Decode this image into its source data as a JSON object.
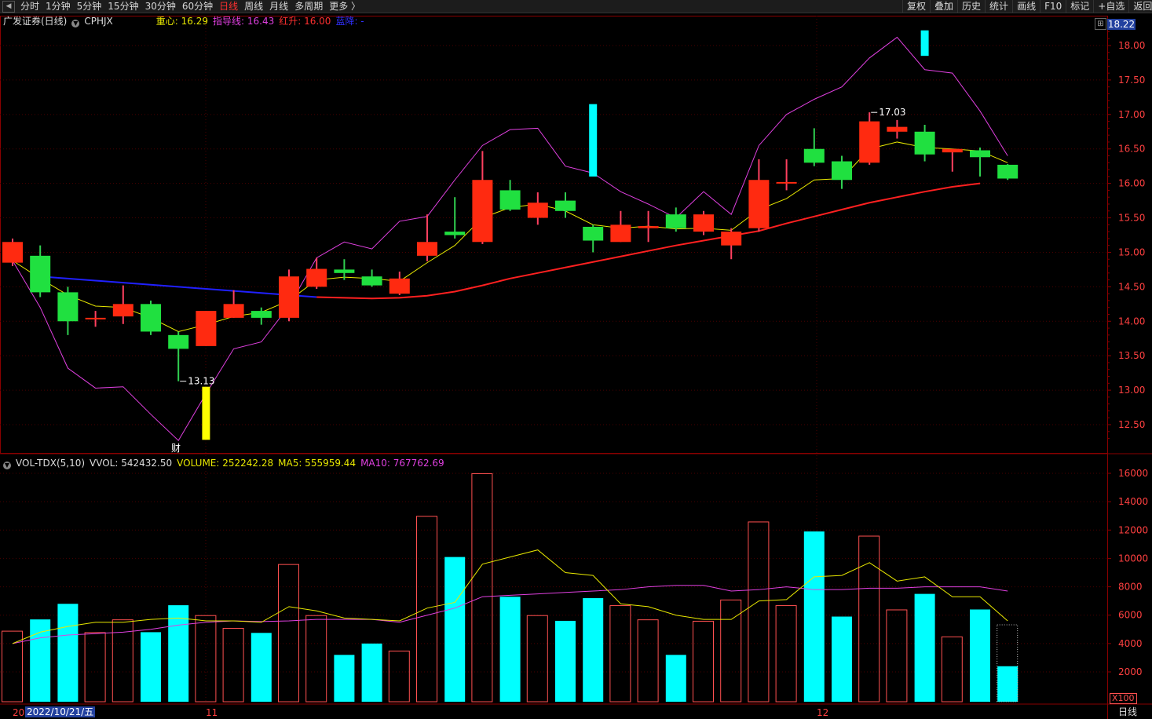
{
  "toolbar": {
    "left_items": [
      "分时",
      "1分钟",
      "5分钟",
      "15分钟",
      "30分钟",
      "60分钟",
      "日线",
      "周线",
      "月线",
      "多周期",
      "更多 〉"
    ],
    "active_item": "日线",
    "right_items": [
      "复权",
      "叠加",
      "历史",
      "统计",
      "画线",
      "F10",
      "标记",
      "+自选",
      "返回"
    ]
  },
  "main_header": {
    "stock_name": "广发证券(日线)",
    "code": "CPHJX",
    "indicators": [
      {
        "label": "重心: 16.29",
        "color": "#e8e800"
      },
      {
        "label": "指导线: 16.43",
        "color": "#e040e0"
      },
      {
        "label": "红升: 16.00",
        "color": "#ff3030"
      },
      {
        "label": "蓝降: -",
        "color": "#3030ff"
      }
    ],
    "box_icon": "⊞"
  },
  "price_tag": "18.22",
  "price_axis": [
    "18.00",
    "17.50",
    "17.00",
    "16.50",
    "16.00",
    "15.50",
    "15.00",
    "14.50",
    "14.00",
    "13.50",
    "13.00",
    "12.50"
  ],
  "annotations": {
    "low": "13.13",
    "high": "17.03",
    "fin_marker": "财"
  },
  "volume_header": {
    "name": "VOL-TDX(5,10)",
    "items": [
      {
        "label": "VVOL: 542432.50",
        "color": "#dddddd"
      },
      {
        "label": "VOLUME: 252242.28",
        "color": "#e8e800"
      },
      {
        "label": "MA5: 555959.44",
        "color": "#e8e800"
      },
      {
        "label": "MA10: 767762.69",
        "color": "#e040e0"
      }
    ]
  },
  "volume_axis": [
    "16000",
    "14000",
    "12000",
    "10000",
    "8000",
    "6000",
    "4000",
    "2000"
  ],
  "volume_unit": "X100",
  "date_axis": {
    "items": [
      "20",
      "11",
      "12"
    ],
    "cursor_date": "2022/10/21/五",
    "period": "日线"
  },
  "colors": {
    "up": "#ff2a10",
    "down": "#20e040",
    "vol_down": "#00ffff",
    "vol_up": "#ff5050",
    "ma_center": "#e8e800",
    "guide": "#e040e0",
    "red_up": "#ff2020",
    "blue_down": "#2020ff",
    "grid": "#4a0000",
    "axis": "#8a0000"
  },
  "chart_data": {
    "type": "candlestick",
    "price_ylim": [
      12.2,
      18.35
    ],
    "volume_ylim": [
      0,
      16500
    ],
    "candles": [
      {
        "o": 14.85,
        "h": 15.2,
        "l": 14.8,
        "c": 15.15
      },
      {
        "o": 14.95,
        "h": 15.1,
        "l": 14.35,
        "c": 14.42
      },
      {
        "o": 14.42,
        "h": 14.5,
        "l": 13.8,
        "c": 14.0
      },
      {
        "o": 14.03,
        "h": 14.15,
        "l": 13.92,
        "c": 14.05
      },
      {
        "o": 14.07,
        "h": 14.52,
        "l": 13.96,
        "c": 14.25
      },
      {
        "o": 14.25,
        "h": 14.3,
        "l": 13.8,
        "c": 13.85
      },
      {
        "o": 13.8,
        "h": 13.85,
        "l": 13.13,
        "c": 13.6
      },
      {
        "o": 13.64,
        "h": 14.15,
        "l": 13.64,
        "c": 14.15
      },
      {
        "o": 14.05,
        "h": 14.45,
        "l": 14.05,
        "c": 14.25
      },
      {
        "o": 14.15,
        "h": 14.2,
        "l": 13.95,
        "c": 14.05
      },
      {
        "o": 14.05,
        "h": 14.75,
        "l": 14.0,
        "c": 14.65
      },
      {
        "o": 14.5,
        "h": 14.92,
        "l": 14.47,
        "c": 14.76
      },
      {
        "o": 14.75,
        "h": 14.9,
        "l": 14.6,
        "c": 14.7
      },
      {
        "o": 14.65,
        "h": 14.75,
        "l": 14.5,
        "c": 14.52
      },
      {
        "o": 14.4,
        "h": 14.72,
        "l": 14.38,
        "c": 14.62
      },
      {
        "o": 14.95,
        "h": 15.55,
        "l": 14.87,
        "c": 15.15
      },
      {
        "o": 15.3,
        "h": 15.8,
        "l": 15.2,
        "c": 15.25
      },
      {
        "o": 15.15,
        "h": 16.47,
        "l": 15.12,
        "c": 16.05
      },
      {
        "o": 15.9,
        "h": 16.05,
        "l": 15.6,
        "c": 15.62
      },
      {
        "o": 15.5,
        "h": 15.87,
        "l": 15.4,
        "c": 15.72
      },
      {
        "o": 15.75,
        "h": 15.87,
        "l": 15.5,
        "c": 15.6
      },
      {
        "o": 15.37,
        "h": 15.4,
        "l": 15.0,
        "c": 15.17
      },
      {
        "o": 15.15,
        "h": 15.6,
        "l": 15.15,
        "c": 15.4
      },
      {
        "o": 15.35,
        "h": 15.6,
        "l": 15.15,
        "c": 15.38
      },
      {
        "o": 15.55,
        "h": 15.65,
        "l": 15.3,
        "c": 15.35
      },
      {
        "o": 15.3,
        "h": 15.6,
        "l": 15.25,
        "c": 15.55
      },
      {
        "o": 15.1,
        "h": 15.35,
        "l": 14.9,
        "c": 15.3
      },
      {
        "o": 15.35,
        "h": 16.35,
        "l": 15.3,
        "c": 16.05
      },
      {
        "o": 16.0,
        "h": 16.35,
        "l": 15.9,
        "c": 16.02
      },
      {
        "o": 16.5,
        "h": 16.8,
        "l": 16.25,
        "c": 16.3
      },
      {
        "o": 16.32,
        "h": 16.4,
        "l": 15.92,
        "c": 16.05
      },
      {
        "o": 16.3,
        "h": 17.03,
        "l": 16.27,
        "c": 16.9
      },
      {
        "o": 16.75,
        "h": 16.92,
        "l": 16.65,
        "c": 16.82
      },
      {
        "o": 16.75,
        "h": 16.85,
        "l": 16.32,
        "c": 16.42
      },
      {
        "o": 16.45,
        "h": 16.5,
        "l": 16.17,
        "c": 16.5
      },
      {
        "o": 16.48,
        "h": 16.52,
        "l": 16.1,
        "c": 16.38
      },
      {
        "o": 16.27,
        "h": 16.28,
        "l": 16.05,
        "c": 16.07
      }
    ],
    "volume": [
      4900,
      5700,
      6800,
      4800,
      5700,
      4800,
      6700,
      6000,
      5100,
      4750,
      9600,
      6000,
      3200,
      4000,
      3500,
      13000,
      10100,
      16000,
      7300,
      6000,
      5600,
      7200,
      6700,
      5700,
      3200,
      5600,
      7100,
      12600,
      6700,
      11900,
      5900,
      11600,
      6400,
      7500,
      4500,
      6400,
      2400
    ],
    "volume_last_outline": 5350,
    "ma_center": [
      14.88,
      14.62,
      14.38,
      14.22,
      14.2,
      14.05,
      13.85,
      13.95,
      14.07,
      14.13,
      14.3,
      14.6,
      14.64,
      14.62,
      14.58,
      14.85,
      15.1,
      15.5,
      15.65,
      15.7,
      15.6,
      15.4,
      15.35,
      15.38,
      15.34,
      15.35,
      15.32,
      15.62,
      15.78,
      16.05,
      16.07,
      16.5,
      16.6,
      16.52,
      16.5,
      16.47,
      16.3
    ],
    "guide_line": [
      14.88,
      14.2,
      13.32,
      13.03,
      13.05,
      12.65,
      12.27,
      12.95,
      13.6,
      13.7,
      14.22,
      14.92,
      15.15,
      15.05,
      15.45,
      15.52,
      16.05,
      16.55,
      16.78,
      16.8,
      16.25,
      16.15,
      15.88,
      15.7,
      15.5,
      15.88,
      15.55,
      16.55,
      17.0,
      17.22,
      17.4,
      17.82,
      18.12,
      17.65,
      17.6,
      17.05,
      16.4
    ],
    "red_up_start": 11,
    "red_up": [
      14.35,
      14.34,
      14.33,
      14.34,
      14.37,
      14.43,
      14.52,
      14.62,
      14.7,
      14.78,
      14.86,
      14.94,
      15.02,
      15.1,
      15.17,
      15.24,
      15.31,
      15.42,
      15.52,
      15.62,
      15.72,
      15.8,
      15.88,
      15.95,
      16.0
    ],
    "blue_down_start": 1,
    "blue_down": [
      14.65,
      14.62,
      14.59,
      14.56,
      14.53,
      14.5,
      14.47,
      14.44,
      14.41,
      14.38,
      14.35
    ],
    "vol_ma5": [
      4000,
      4800,
      5200,
      5500,
      5500,
      5700,
      5800,
      5600,
      5600,
      5500,
      6600,
      6300,
      5800,
      5700,
      5600,
      6500,
      6900,
      9600,
      10100,
      10600,
      9000,
      8800,
      6800,
      6600,
      6000,
      5700,
      5700,
      7000,
      7100,
      8700,
      8800,
      9700,
      8400,
      8700,
      7300,
      7300,
      5600
    ],
    "vol_ma10": [
      4000,
      4400,
      4600,
      4700,
      4800,
      5000,
      5300,
      5500,
      5600,
      5550,
      5600,
      5700,
      5700,
      5700,
      5500,
      6000,
      6500,
      7300,
      7400,
      7500,
      7600,
      7700,
      7800,
      8000,
      8100,
      8100,
      7700,
      7800,
      8000,
      7800,
      7800,
      7900,
      7900,
      8000,
      8000,
      8000,
      7700
    ],
    "cyan_signals": [
      {
        "index": 21,
        "top": 17.15,
        "bottom": 16.1
      },
      {
        "index": 33,
        "top": 18.22,
        "bottom": 17.85
      }
    ],
    "yellow_signal": {
      "index": 7,
      "top": 13.05,
      "bottom": 12.28
    }
  }
}
